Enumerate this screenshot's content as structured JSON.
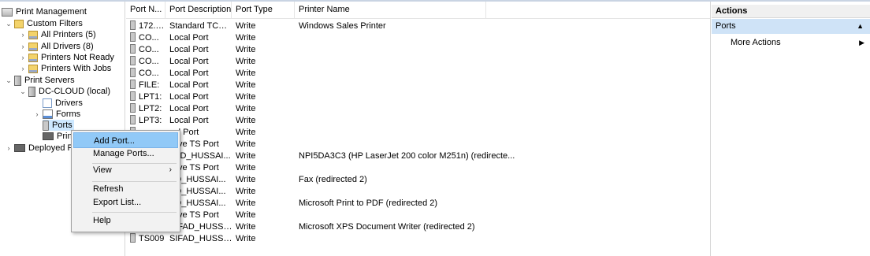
{
  "tree": {
    "root": "Print Management",
    "custom_filters": "Custom Filters",
    "all_printers": "All Printers (5)",
    "all_drivers": "All Drivers (8)",
    "printers_not_ready": "Printers Not Ready",
    "printers_with_jobs": "Printers With Jobs",
    "print_servers": "Print Servers",
    "server": "DC-CLOUD (local)",
    "drivers": "Drivers",
    "forms": "Forms",
    "ports": "Ports",
    "printers_partial": "Print",
    "deployed_partial": "Deployed P"
  },
  "list": {
    "columns": [
      "Port N...",
      "Port Description",
      "Port Type",
      "Printer Name"
    ],
    "rows": [
      [
        "172.1...",
        "Standard TCP/I...",
        "Write",
        "Windows Sales Printer"
      ],
      [
        "CO...",
        "Local Port",
        "Write",
        ""
      ],
      [
        "CO...",
        "Local Port",
        "Write",
        ""
      ],
      [
        "CO...",
        "Local Port",
        "Write",
        ""
      ],
      [
        "CO...",
        "Local Port",
        "Write",
        ""
      ],
      [
        "FILE:",
        "Local Port",
        "Write",
        ""
      ],
      [
        "LPT1:",
        "Local Port",
        "Write",
        ""
      ],
      [
        "LPT2:",
        "Local Port",
        "Write",
        ""
      ],
      [
        "LPT3:",
        "Local Port",
        "Write",
        ""
      ],
      [
        "",
        "cal Port",
        "Write",
        ""
      ],
      [
        "",
        "ctive TS Port",
        "Write",
        ""
      ],
      [
        "",
        "FAD_HUSSAI...",
        "Write",
        "NPI5DA3C3 (HP LaserJet 200 color M251n) (redirecte..."
      ],
      [
        "",
        "ctive TS Port",
        "Write",
        ""
      ],
      [
        "",
        "AD_HUSSAI...",
        "Write",
        "Fax (redirected 2)"
      ],
      [
        "",
        "AD_HUSSAI...",
        "Write",
        ""
      ],
      [
        "",
        "AD_HUSSAI...",
        "Write",
        "Microsoft Print to PDF (redirected 2)"
      ],
      [
        "",
        "ctive TS Port",
        "Write",
        ""
      ],
      [
        "TS008",
        "SIFAD_HUSSAI...",
        "Write",
        "Microsoft XPS Document Writer (redirected 2)"
      ],
      [
        "TS009",
        "SIFAD_HUSSAI...",
        "Write",
        ""
      ]
    ]
  },
  "actions": {
    "title": "Actions",
    "section": "Ports",
    "more_actions": "More Actions"
  },
  "context_menu": {
    "add_port": "Add Port...",
    "manage_ports": "Manage Ports...",
    "view": "View",
    "refresh": "Refresh",
    "export_list": "Export List...",
    "help": "Help"
  }
}
